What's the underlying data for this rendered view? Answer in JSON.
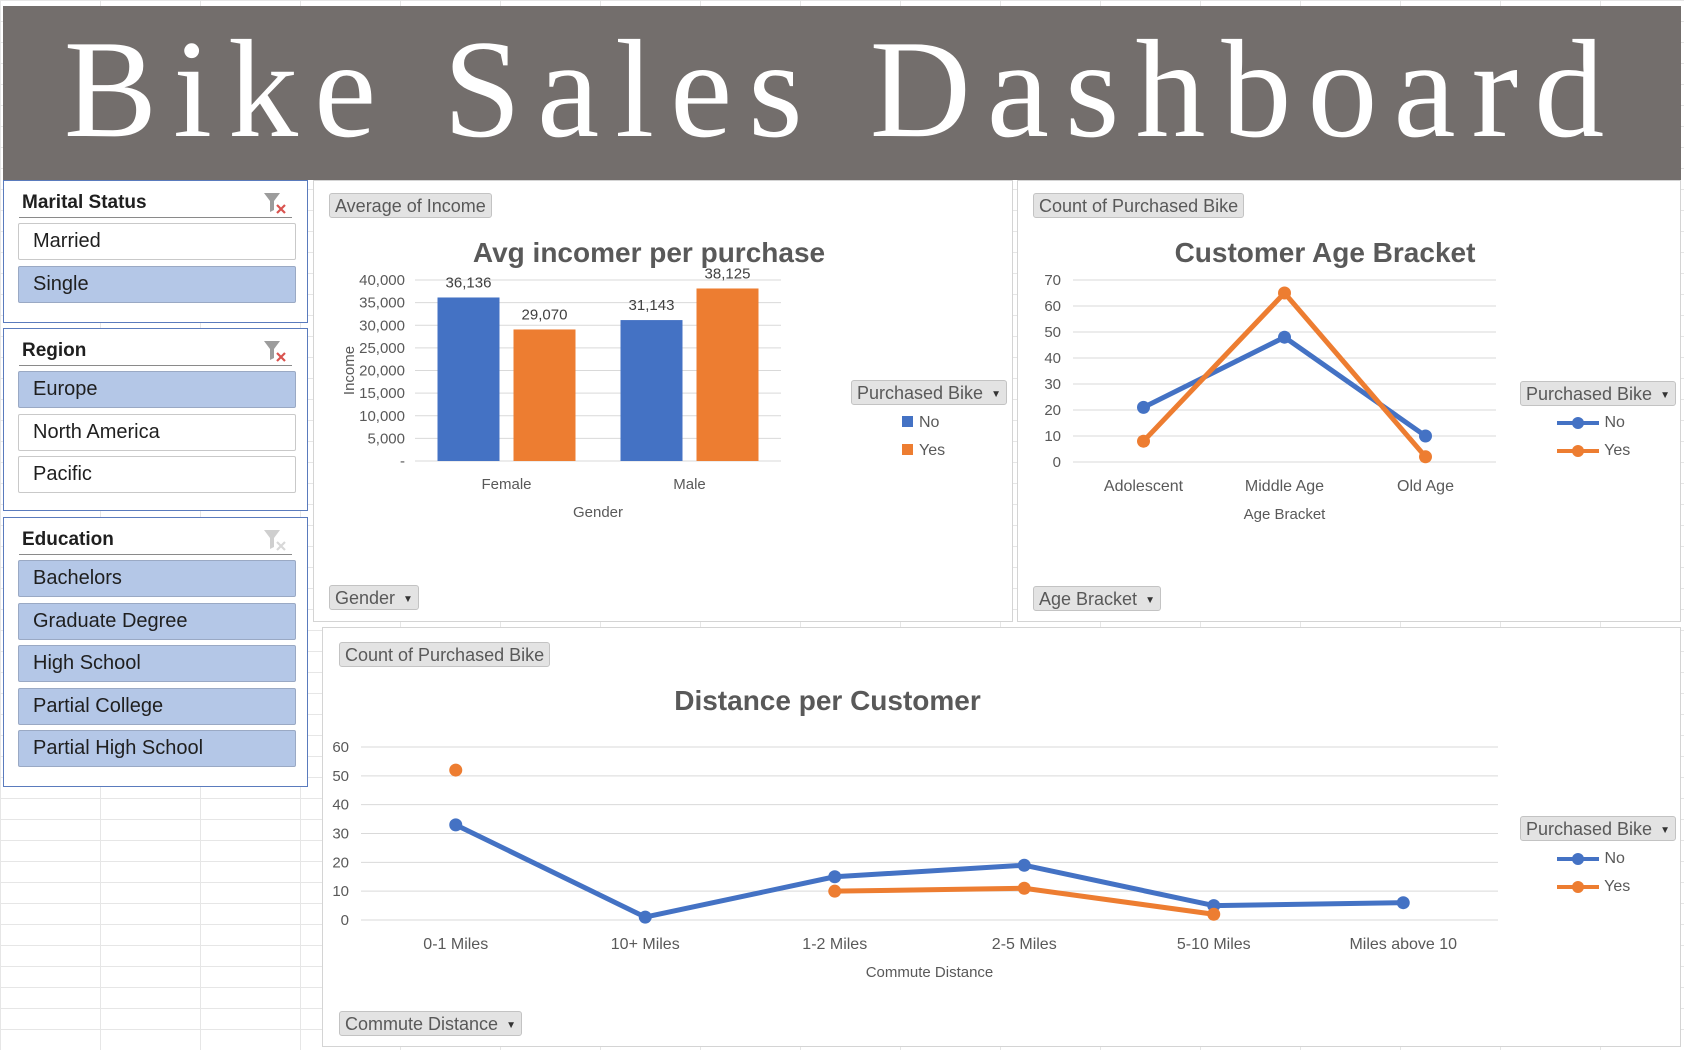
{
  "dashboard_title": "Bike Sales Dashboard",
  "colors": {
    "no": "#4472c4",
    "yes": "#ed7d31",
    "banner": "#736e6c",
    "slicer_selected": "#b4c7e7"
  },
  "slicers": {
    "marital": {
      "title": "Marital Status",
      "items": [
        {
          "label": "Married",
          "selected": false
        },
        {
          "label": "Single",
          "selected": true
        }
      ]
    },
    "region": {
      "title": "Region",
      "items": [
        {
          "label": "Europe",
          "selected": true
        },
        {
          "label": "North America",
          "selected": false
        },
        {
          "label": "Pacific",
          "selected": false
        }
      ]
    },
    "education": {
      "title": "Education",
      "items": [
        {
          "label": "Bachelors",
          "selected": true
        },
        {
          "label": "Graduate Degree",
          "selected": true
        },
        {
          "label": "High School",
          "selected": true
        },
        {
          "label": "Partial College",
          "selected": true
        },
        {
          "label": "Partial High School",
          "selected": true
        }
      ]
    }
  },
  "legend": {
    "title": "Purchased Bike",
    "no": "No",
    "yes": "Yes"
  },
  "chart_income": {
    "value_button": "Average of Income",
    "axis_button": "Gender"
  },
  "chart_age": {
    "value_button": "Count of Purchased Bike",
    "axis_button": "Age Bracket"
  },
  "chart_distance": {
    "value_button": "Count of Purchased Bike",
    "axis_button": "Commute Distance"
  },
  "chart_data": [
    {
      "type": "bar",
      "title": "Avg incomer per purchase",
      "xlabel": "Gender",
      "ylabel": "Income",
      "categories": [
        "Female",
        "Male"
      ],
      "series": [
        {
          "name": "No",
          "values": [
            36136,
            31143
          ]
        },
        {
          "name": "Yes",
          "values": [
            29070,
            38125
          ]
        }
      ],
      "data_labels": [
        [
          "36,136",
          "31,143"
        ],
        [
          "29,070",
          "38,125"
        ]
      ],
      "ylim": [
        0,
        40000
      ],
      "yticks": [
        "-",
        "5,000",
        "10,000",
        "15,000",
        "20,000",
        "25,000",
        "30,000",
        "35,000",
        "40,000"
      ],
      "grid": true,
      "legend_position": "right"
    },
    {
      "type": "line",
      "title": "Customer Age Bracket",
      "xlabel": "Age Bracket",
      "ylabel": "",
      "categories": [
        "Adolescent",
        "Middle Age",
        "Old Age"
      ],
      "series": [
        {
          "name": "No",
          "values": [
            21,
            48,
            10
          ]
        },
        {
          "name": "Yes",
          "values": [
            8,
            65,
            2
          ]
        }
      ],
      "ylim": [
        0,
        70
      ],
      "yticks": [
        "0",
        "10",
        "20",
        "30",
        "40",
        "50",
        "60",
        "70"
      ],
      "grid": true,
      "legend_position": "right"
    },
    {
      "type": "line",
      "title": "Distance per Customer",
      "xlabel": "Commute Distance",
      "ylabel": "",
      "categories": [
        "0-1 Miles",
        "10+ Miles",
        "1-2 Miles",
        "2-5 Miles",
        "5-10 Miles",
        "Miles above 10"
      ],
      "series": [
        {
          "name": "No",
          "values": [
            33,
            1,
            15,
            19,
            5,
            6
          ]
        },
        {
          "name": "Yes",
          "values": [
            52,
            null,
            10,
            11,
            2,
            null
          ]
        }
      ],
      "ylim": [
        0,
        60
      ],
      "yticks": [
        "0",
        "10",
        "20",
        "30",
        "40",
        "50",
        "60"
      ],
      "grid": true,
      "legend_position": "right"
    }
  ]
}
